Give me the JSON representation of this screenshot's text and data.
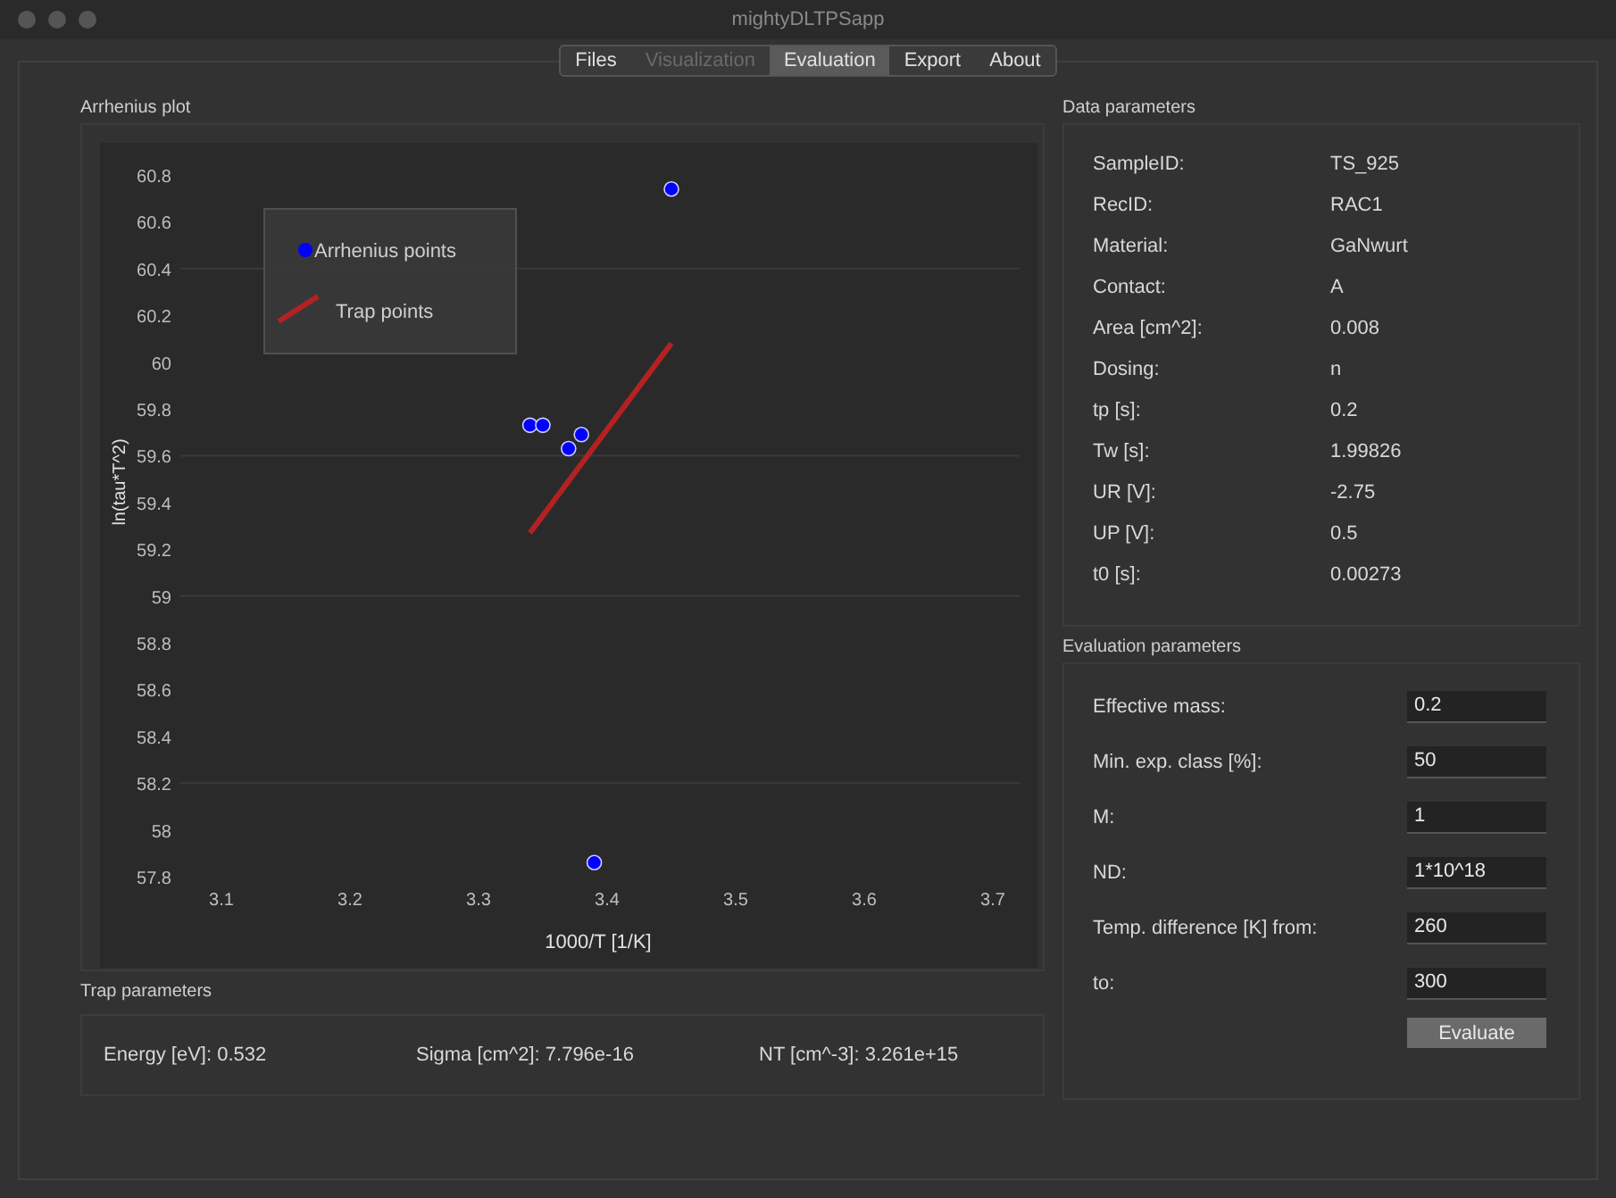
{
  "window": {
    "title": "mightyDLTPSapp"
  },
  "tabs": [
    {
      "label": "Files",
      "selected": false,
      "disabled": false
    },
    {
      "label": "Visualization",
      "selected": false,
      "disabled": true
    },
    {
      "label": "Evaluation",
      "selected": true,
      "disabled": false
    },
    {
      "label": "Export",
      "selected": false,
      "disabled": false
    },
    {
      "label": "About",
      "selected": false,
      "disabled": false
    }
  ],
  "arrhenius_plot": {
    "title": "Arrhenius plot",
    "chart_data": {
      "type": "scatter",
      "grid": true,
      "legend": true,
      "xlabel": "1000/T [1/K]",
      "ylabel": "ln(tau*T^2)",
      "xlim": [
        3.1,
        3.7
      ],
      "ylim": [
        57.8,
        60.8
      ],
      "xticks": [
        {
          "value": 3.1,
          "label": "3.1"
        },
        {
          "value": 3.2,
          "label": "3.2"
        },
        {
          "value": 3.3,
          "label": "3.3"
        },
        {
          "value": 3.4,
          "label": "3.4"
        },
        {
          "value": 3.5,
          "label": "3.5"
        },
        {
          "value": 3.6,
          "label": "3.6"
        },
        {
          "value": 3.7,
          "label": "3.7"
        }
      ],
      "yticks": [
        {
          "value": 60.8,
          "label": "60.8"
        },
        {
          "value": 60.6,
          "label": "60.6"
        },
        {
          "value": 60.4,
          "label": "60.4"
        },
        {
          "value": 60.2,
          "label": "60.2"
        },
        {
          "value": 60,
          "label": "60"
        },
        {
          "value": 59.8,
          "label": "59.8"
        },
        {
          "value": 59.6,
          "label": "59.6"
        },
        {
          "value": 59.4,
          "label": "59.4"
        },
        {
          "value": 59.2,
          "label": "59.2"
        },
        {
          "value": 59,
          "label": "59"
        },
        {
          "value": 58.8,
          "label": "58.8"
        },
        {
          "value": 58.6,
          "label": "58.6"
        },
        {
          "value": 58.4,
          "label": "58.4"
        },
        {
          "value": 58.2,
          "label": "58.2"
        },
        {
          "value": 58,
          "label": "58"
        },
        {
          "value": 57.8,
          "label": "57.8"
        }
      ],
      "series": [
        {
          "name": "Arrhenius points",
          "type": "scatter",
          "color": "#0000ff",
          "x": [
            3.45,
            3.34,
            3.35,
            3.38,
            3.37,
            3.39
          ],
          "values": [
            60.74,
            59.73,
            59.73,
            59.69,
            59.63,
            57.86
          ]
        },
        {
          "name": "Trap points",
          "type": "line",
          "color": "#b22222",
          "x": [
            3.34,
            3.45
          ],
          "values": [
            59.27,
            60.08
          ]
        }
      ]
    }
  },
  "trap_parameters": {
    "title": "Trap parameters",
    "items": [
      "Energy [eV]: 0.532",
      "Sigma [cm^2]: 7.796e-16",
      "NT [cm^-3]: 3.261e+15"
    ]
  },
  "data_parameters": {
    "title": "Data parameters",
    "rows": [
      {
        "label": "SampleID:",
        "value": "TS_925"
      },
      {
        "label": "RecID:",
        "value": "RAC1"
      },
      {
        "label": "Material:",
        "value": "GaNwurt"
      },
      {
        "label": "Contact:",
        "value": "A"
      },
      {
        "label": "Area [cm^2]:",
        "value": "0.008"
      },
      {
        "label": "Dosing:",
        "value": "n"
      },
      {
        "label": "tp [s]:",
        "value": "0.2"
      },
      {
        "label": "Tw [s]:",
        "value": "1.99826"
      },
      {
        "label": "UR [V]:",
        "value": "-2.75"
      },
      {
        "label": "UP [V]:",
        "value": "0.5"
      },
      {
        "label": "t0 [s]:",
        "value": "0.00273"
      }
    ]
  },
  "evaluation_parameters": {
    "title": "Evaluation parameters",
    "fields": [
      {
        "label": "Effective mass:",
        "value": "0.2"
      },
      {
        "label": "Min. exp. class [%]:",
        "value": "50"
      },
      {
        "label": "M:",
        "value": "1"
      },
      {
        "label": "ND:",
        "value": "1*10^18"
      },
      {
        "label": "Temp. difference [K] from:",
        "value": "260"
      },
      {
        "label": "to:",
        "value": "300"
      }
    ],
    "button": "Evaluate"
  }
}
